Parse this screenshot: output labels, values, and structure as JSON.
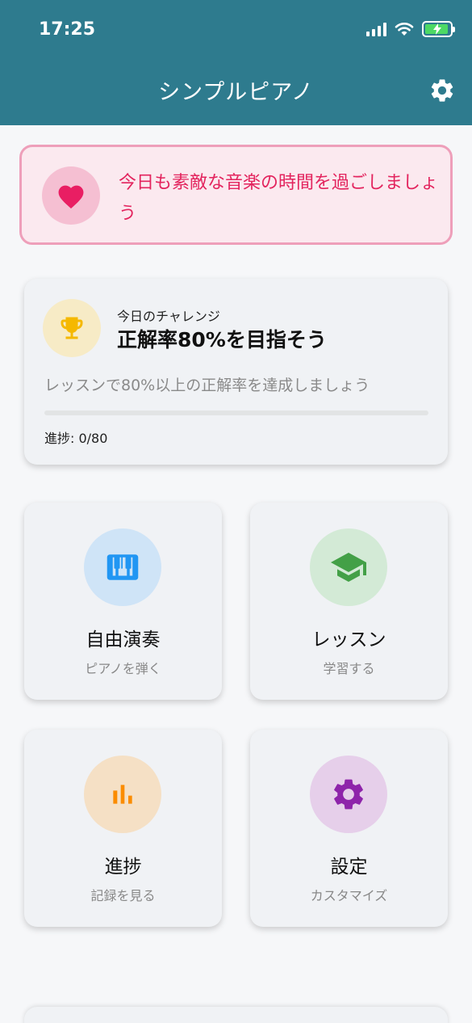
{
  "status_bar": {
    "time": "17:25"
  },
  "header": {
    "title": "シンプルピアノ",
    "settings_icon": "gear-icon"
  },
  "banner": {
    "message": "今日も素敵な音楽の時間を過ごしましょう",
    "icon": "heart-icon",
    "accent": "#e3245e"
  },
  "challenge": {
    "label": "今日のチャレンジ",
    "title": "正解率80%を目指そう",
    "description": "レッスンで80%以上の正解率を達成しましょう",
    "progress_text": "進捗: 0/80",
    "progress_value": 0,
    "progress_max": 80,
    "icon": "trophy-icon"
  },
  "menu": [
    {
      "title": "自由演奏",
      "subtitle": "ピアノを弾く",
      "icon": "piano-icon",
      "color": "#2196f3",
      "bg": "#cfe4f7"
    },
    {
      "title": "レッスン",
      "subtitle": "学習する",
      "icon": "graduation-cap-icon",
      "color": "#43a047",
      "bg": "#d3ead6"
    },
    {
      "title": "進捗",
      "subtitle": "記録を見る",
      "icon": "bar-chart-icon",
      "color": "#fb8c00",
      "bg": "#f5e0c5"
    },
    {
      "title": "設定",
      "subtitle": "カスタマイズ",
      "icon": "gear-icon",
      "color": "#8e24aa",
      "bg": "#e6cfea"
    }
  ]
}
